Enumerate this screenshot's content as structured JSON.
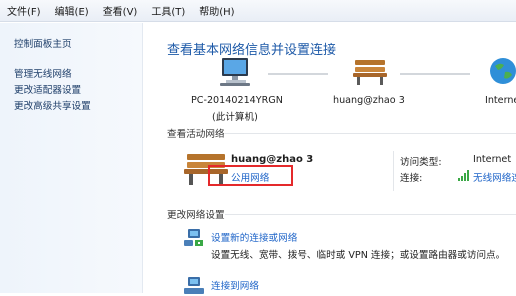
{
  "menu": [
    "文件(F)",
    "编辑(E)",
    "查看(V)",
    "工具(T)",
    "帮助(H)"
  ],
  "sidebar": {
    "home": "控制面板主页",
    "items": [
      "管理无线网络",
      "更改适配器设置",
      "更改高级共享设置"
    ]
  },
  "main": {
    "heading": "查看基本网络信息并设置连接",
    "map": {
      "computer_name": "PC-20140214YRGN",
      "computer_sub": "(此计算机)",
      "network": "huang@zhao  3",
      "internet": "Internet"
    },
    "active_title": "查看活动网络",
    "active": {
      "name": "huang@zhao  3",
      "type": "公用网络",
      "access_label": "访问类型:",
      "access_value": "Internet",
      "conn_label": "连接:",
      "conn_value": "无线网络连"
    },
    "change_title": "更改网络设置",
    "tasks": [
      {
        "link": "设置新的连接或网络",
        "desc": "设置无线、宽带、拨号、临时或 VPN 连接；或设置路由器或访问点。"
      },
      {
        "link": "连接到网络"
      }
    ]
  },
  "colors": {
    "link": "#1e64c8",
    "heading": "#1e5aa8",
    "highlight": "#e4292b"
  }
}
